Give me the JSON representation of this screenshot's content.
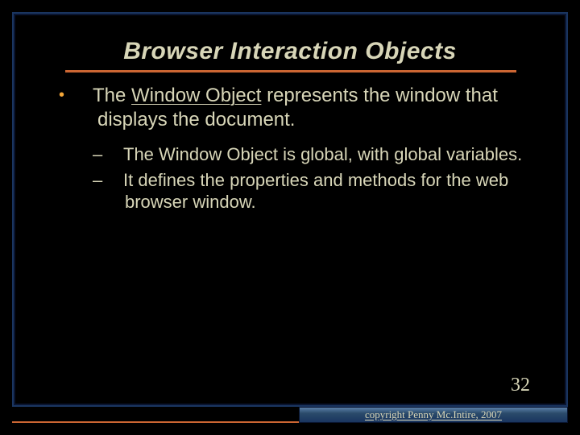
{
  "title": "Browser Interaction Objects",
  "main_bullet": {
    "prefix": "The ",
    "underlined": "Window Object",
    "suffix": " represents the window that displays the document."
  },
  "sub_bullets": [
    "The Window Object is global, with global variables.",
    "It defines the properties and methods for the web browser window."
  ],
  "page_number": "32",
  "copyright": "copyright Penny Mc.Intire, 2007"
}
